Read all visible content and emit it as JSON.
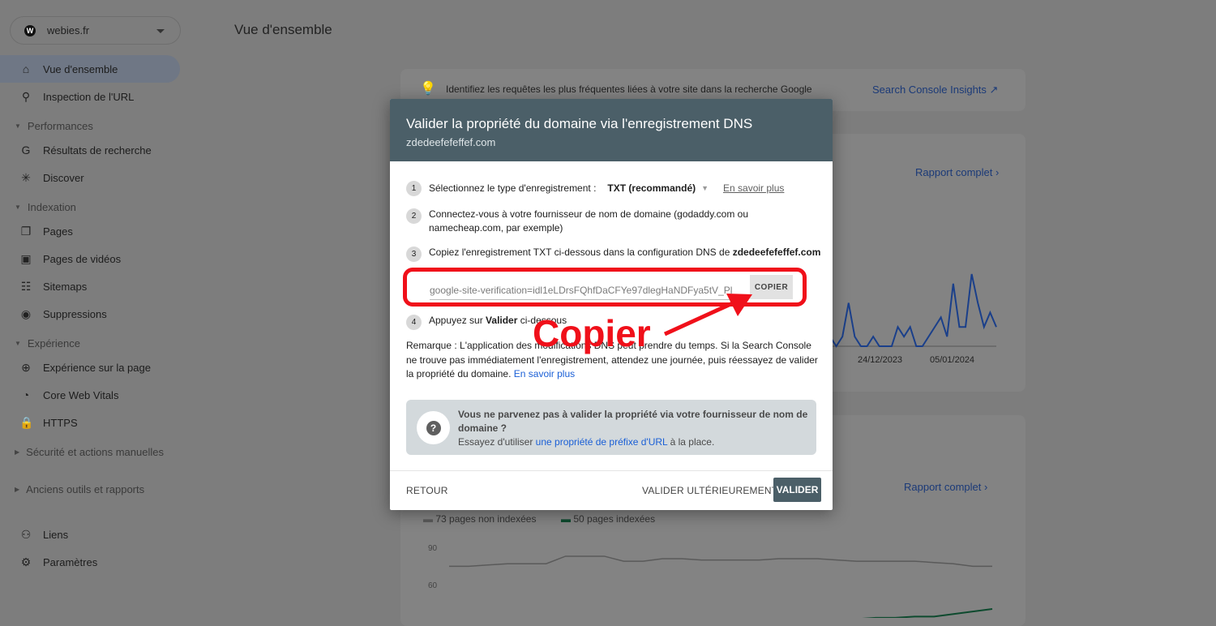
{
  "property": {
    "name": "webies.fr",
    "logo_letter": "W"
  },
  "page_title": "Vue d'ensemble",
  "sidebar": {
    "items": [
      {
        "label": "Vue d'ensemble",
        "icon": "home-icon",
        "glyph": "⌂",
        "active": true
      },
      {
        "label": "Inspection de l'URL",
        "icon": "search-icon",
        "glyph": "⚲"
      }
    ],
    "sections": [
      {
        "label": "Performances",
        "items": [
          {
            "label": "Résultats de recherche",
            "icon": "google-icon",
            "glyph": "G"
          },
          {
            "label": "Discover",
            "icon": "asterisk-icon",
            "glyph": "✳"
          }
        ]
      },
      {
        "label": "Indexation",
        "items": [
          {
            "label": "Pages",
            "icon": "pages-icon",
            "glyph": "❐"
          },
          {
            "label": "Pages de vidéos",
            "icon": "video-pages-icon",
            "glyph": "▣"
          },
          {
            "label": "Sitemaps",
            "icon": "sitemap-icon",
            "glyph": "☷"
          },
          {
            "label": "Suppressions",
            "icon": "eye-off-icon",
            "glyph": "◉"
          }
        ]
      },
      {
        "label": "Expérience",
        "items": [
          {
            "label": "Expérience sur la page",
            "icon": "plus-circle-icon",
            "glyph": "⊕"
          },
          {
            "label": "Core Web Vitals",
            "icon": "gauge-icon",
            "glyph": "◔"
          },
          {
            "label": "HTTPS",
            "icon": "lock-icon",
            "glyph": "🔒"
          }
        ]
      },
      {
        "label": "Sécurité et actions manuelles",
        "collapsed": true
      },
      {
        "label": "Anciens outils et rapports",
        "collapsed": true
      }
    ],
    "bottom": [
      {
        "label": "Liens",
        "icon": "links-icon",
        "glyph": "⚇"
      },
      {
        "label": "Paramètres",
        "icon": "settings-icon",
        "glyph": "⚙"
      }
    ]
  },
  "insights_banner": {
    "text": "Identifiez les requêtes les plus fréquentes liées à votre site dans la recherche Google",
    "link": "Search Console Insights"
  },
  "performance_card": {
    "link": "Rapport complet",
    "x_ticks": [
      "24/12/2023",
      "05/01/2024"
    ],
    "series_color": "#1a3f8a",
    "values": [
      3,
      1,
      3,
      10,
      3,
      1,
      1,
      3,
      1,
      1,
      1,
      5,
      3,
      5,
      1,
      1,
      3,
      5,
      7,
      3,
      14,
      5,
      5,
      16,
      10,
      5,
      8,
      5
    ]
  },
  "indexing_card": {
    "link": "Rapport complet",
    "legend": [
      {
        "label": "73 pages non indexées",
        "color": "#5a5a5a"
      },
      {
        "label": "50 pages indexées",
        "color": "#0d4a2e"
      }
    ],
    "y_ticks": [
      "90",
      "60"
    ],
    "non_indexed": [
      78,
      78,
      79,
      80,
      80,
      80,
      86,
      86,
      86,
      82,
      82,
      84,
      84,
      83,
      83,
      83,
      83,
      84,
      84,
      84,
      83,
      82,
      82,
      82,
      82,
      81,
      80,
      78,
      78
    ],
    "indexed": [
      30,
      30,
      30,
      30,
      30,
      30,
      30,
      30,
      30,
      30,
      30,
      30,
      31,
      31,
      31,
      31,
      33,
      33,
      34,
      34,
      36,
      36,
      37,
      37,
      38,
      38,
      40,
      42,
      44
    ]
  },
  "dialog": {
    "title": "Valider la propriété du domaine via l'enregistrement DNS",
    "domain": "zdedeefefeffef.com",
    "step1": {
      "num": "1",
      "label": "Sélectionnez le type d'enregistrement :",
      "value": "TXT (recommandé)",
      "link": "En savoir plus"
    },
    "step2": {
      "num": "2",
      "text": "Connectez-vous à votre fournisseur de nom de domaine (godaddy.com ou namecheap.com, par exemple)"
    },
    "step3": {
      "num": "3",
      "text": "Copiez l'enregistrement TXT ci-dessous dans la configuration DNS de ",
      "domain": "zdedeefefeffef.com"
    },
    "txt_record": "google-site-verification=idl1eLDrsFQhfDaCFYe97dlegHaNDFya5tV_Pl",
    "copy_button": "COPIER",
    "step4": {
      "num": "4",
      "pre": "Appuyez sur ",
      "bold": "Valider",
      "post": " ci-dessous"
    },
    "note": "Remarque : L'application des modifications DNS peut prendre du temps. Si la Search Console ne trouve pas immédiatement l'enregistrement, attendez une journée, puis réessayez de valider la propriété du domaine.",
    "note_link": "En savoir plus",
    "help": {
      "title": "Vous ne parvenez pas à valider la propriété via votre fournisseur de nom de domaine ?",
      "pre": "Essayez d'utiliser ",
      "link": "une propriété de préfixe d'URL",
      "post": " à la place."
    },
    "back": "RETOUR",
    "later": "VALIDER ULTÉRIEUREMENT",
    "validate": "VALIDER"
  },
  "annotation": {
    "label": "Copier",
    "color": "#f0101a"
  }
}
